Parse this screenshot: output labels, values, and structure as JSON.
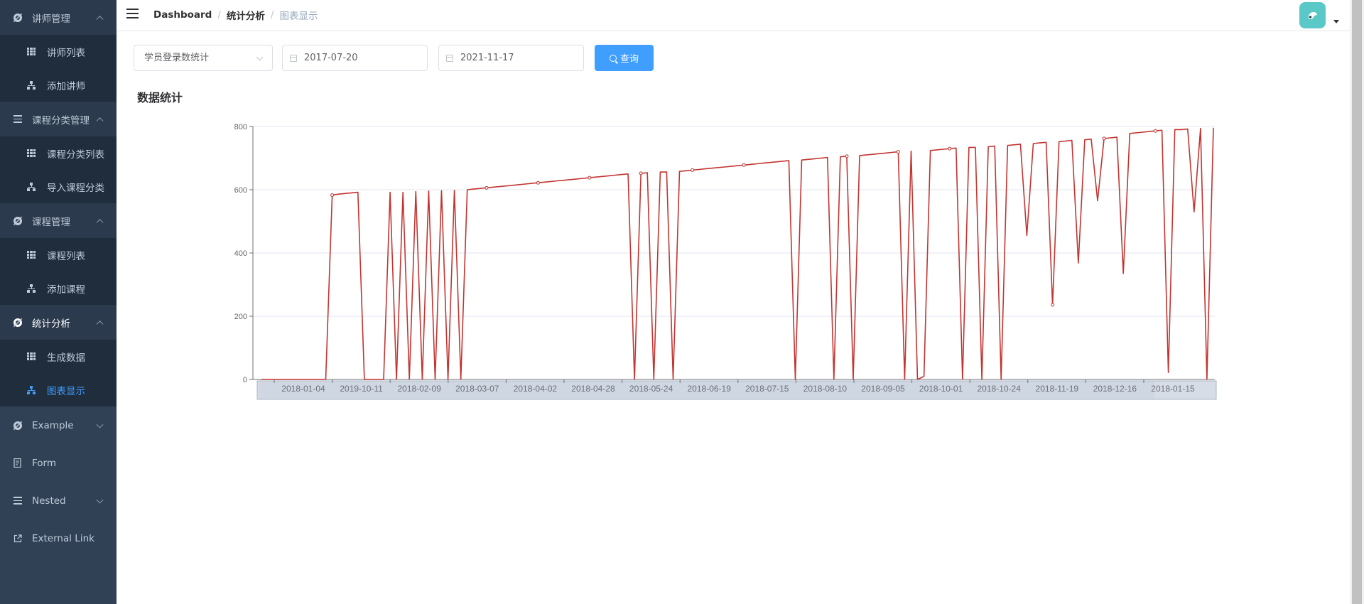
{
  "sidebar": {
    "groups": [
      {
        "title": "讲师管理",
        "icon": "gear-icon",
        "items": [
          {
            "label": "讲师列表",
            "icon": "table-icon"
          },
          {
            "label": "添加讲师",
            "icon": "tree-icon"
          }
        ]
      },
      {
        "title": "课程分类管理",
        "icon": "list-icon",
        "items": [
          {
            "label": "课程分类列表",
            "icon": "table-icon"
          },
          {
            "label": "导入课程分类",
            "icon": "tree-icon"
          }
        ]
      },
      {
        "title": "课程管理",
        "icon": "gear-icon",
        "items": [
          {
            "label": "课程列表",
            "icon": "table-icon"
          },
          {
            "label": "添加课程",
            "icon": "tree-icon"
          }
        ]
      },
      {
        "title": "统计分析",
        "icon": "gear-icon",
        "items": [
          {
            "label": "生成数据",
            "icon": "table-icon"
          },
          {
            "label": "图表显示",
            "icon": "tree-icon",
            "active": true
          }
        ]
      }
    ],
    "bottom": [
      {
        "title": "Example",
        "icon": "gear-icon"
      },
      {
        "title": "Form",
        "icon": "form-icon"
      },
      {
        "title": "Nested",
        "icon": "list-icon"
      },
      {
        "title": "External Link",
        "icon": "external-link-icon"
      }
    ]
  },
  "header": {
    "breadcrumb": [
      "Dashboard",
      "统计分析",
      "图表显示"
    ]
  },
  "filters": {
    "type_select": "学员登录数统计",
    "start_date": "2017-07-20",
    "end_date": "2021-11-17",
    "query_label": "查询"
  },
  "section_title": "数据统计",
  "colors": {
    "accent": "#409eff",
    "sidebar": "#304156",
    "line": "#c23531"
  },
  "chart_data": {
    "type": "line",
    "title": "",
    "xlabel": "",
    "ylabel": "",
    "ylim": [
      0,
      800
    ],
    "y_ticks": [
      0,
      200,
      400,
      600,
      800
    ],
    "x_tick_labels": [
      "2018-01-04",
      "2019-10-11",
      "2018-02-09",
      "2018-03-07",
      "2018-04-02",
      "2018-04-28",
      "2018-05-24",
      "2018-06-19",
      "2018-07-15",
      "2018-08-10",
      "2018-09-05",
      "2018-10-01",
      "2018-10-24",
      "2018-11-19",
      "2018-12-16",
      "2018-01-15"
    ],
    "grid": true,
    "legend": false,
    "data_zoom": true,
    "series": [
      {
        "values": [
          0,
          0,
          0,
          0,
          0,
          0,
          0,
          0,
          0,
          0,
          0,
          583,
          586,
          588,
          590,
          592,
          0,
          0,
          0,
          0,
          592,
          0,
          592,
          0,
          594,
          0,
          596,
          0,
          597,
          0,
          598,
          0,
          600,
          602,
          604,
          606,
          608,
          610,
          612,
          614,
          616,
          618,
          620,
          622,
          624,
          626,
          628,
          630,
          632,
          634,
          636,
          638,
          640,
          642,
          644,
          646,
          648,
          650,
          0,
          652,
          654,
          0,
          656,
          656,
          0,
          658,
          660,
          662,
          664,
          666,
          668,
          670,
          672,
          674,
          676,
          678,
          680,
          682,
          684,
          686,
          688,
          690,
          692,
          0,
          694,
          696,
          698,
          700,
          702,
          0,
          704,
          706,
          0,
          708,
          710,
          712,
          714,
          716,
          718,
          720,
          0,
          722,
          0,
          10,
          724,
          726,
          728,
          730,
          732,
          0,
          734,
          734,
          0,
          736,
          738,
          0,
          740,
          742,
          744,
          455,
          746,
          748,
          750,
          236,
          752,
          754,
          756,
          368,
          758,
          760,
          565,
          762,
          764,
          766,
          335,
          778,
          780,
          782,
          784,
          786,
          788,
          22,
          790,
          790,
          792,
          530,
          794,
          0,
          796
        ]
      }
    ]
  }
}
